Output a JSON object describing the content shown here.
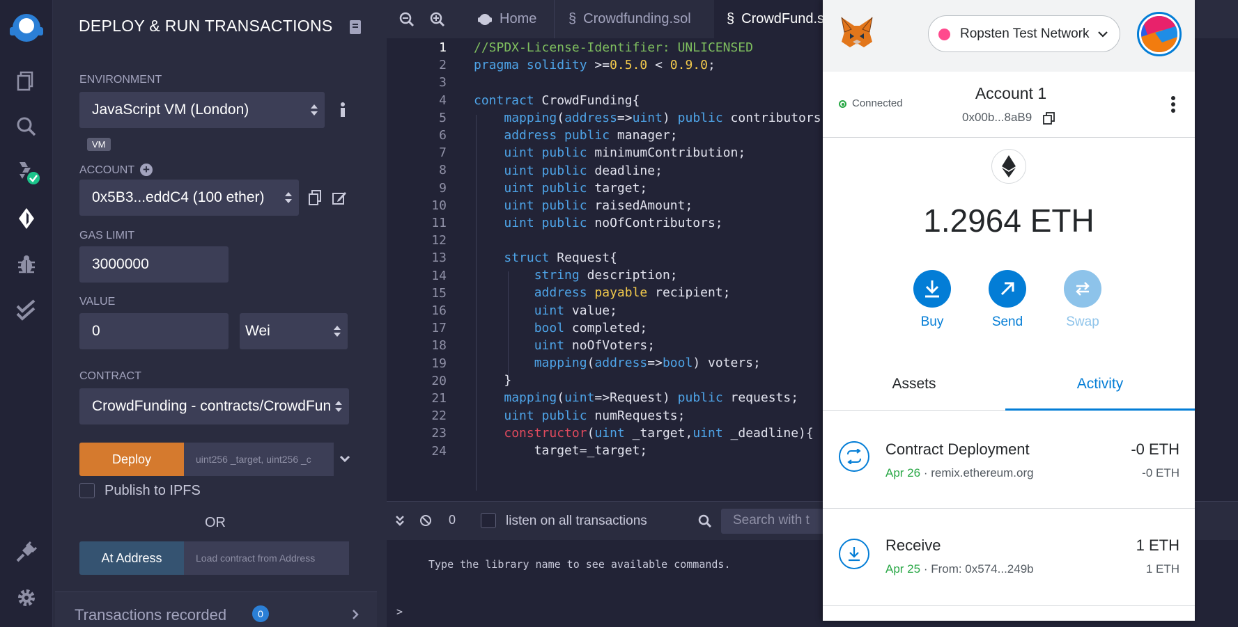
{
  "iconbar": {
    "items": [
      "remix-logo-icon",
      "file-explorer-icon",
      "search-icon",
      "compiler-icon",
      "deploy-icon",
      "debugger-icon",
      "testing-icon",
      "plugin-icon",
      "settings-icon"
    ]
  },
  "panel": {
    "title": "DEPLOY & RUN TRANSACTIONS",
    "environment_label": "ENVIRONMENT",
    "environment_value": "JavaScript VM (London)",
    "vm_badge": "VM",
    "account_label": "ACCOUNT",
    "account_value": "0x5B3...eddC4 (100 ether)",
    "gas_limit_label": "GAS LIMIT",
    "gas_limit_value": "3000000",
    "value_label": "VALUE",
    "value_amount": "0",
    "value_unit": "Wei",
    "contract_label": "CONTRACT",
    "contract_value": "CrowdFunding - contracts/CrowdFun",
    "deploy_label": "Deploy",
    "deploy_params_placeholder": "uint256 _target, uint256 _c",
    "publish_label": "Publish to IPFS",
    "or_label": "OR",
    "at_address_label": "At Address",
    "at_address_placeholder": "Load contract from Address",
    "transactions_recorded_label": "Transactions recorded",
    "transactions_recorded_count": "0"
  },
  "editor": {
    "tabs": [
      {
        "label": "Home"
      },
      {
        "label": "Crowdfunding.sol"
      },
      {
        "label": "CrowdFund.s"
      }
    ],
    "lines": [
      "1",
      "2",
      "3",
      "4",
      "5",
      "6",
      "7",
      "8",
      "9",
      "10",
      "11",
      "12",
      "13",
      "14",
      "15",
      "16",
      "17",
      "18",
      "19",
      "20",
      "21",
      "22",
      "23",
      "24"
    ]
  },
  "terminal": {
    "count": "0",
    "listen_label": "listen on all transactions",
    "search_placeholder": "Search with t",
    "message": "Type the library name to see available commands.",
    "prompt": ">"
  },
  "metamask": {
    "network": "Ropsten Test Network",
    "connected_label": "Connected",
    "account_name": "Account 1",
    "account_address": "0x00b...8aB9",
    "balance": "1.2964 ETH",
    "buy_label": "Buy",
    "send_label": "Send",
    "swap_label": "Swap",
    "assets_tab": "Assets",
    "activity_tab": "Activity",
    "activity": [
      {
        "title": "Contract Deployment",
        "date": "Apr 26",
        "detail": "remix.ethereum.org",
        "amount": "-0 ETH",
        "sub_amount": "-0 ETH"
      },
      {
        "title": "Receive",
        "date": "Apr 25",
        "detail": "From: 0x574...249b",
        "amount": "1 ETH",
        "sub_amount": "1 ETH"
      }
    ],
    "colors": {
      "accent": "#037dd6",
      "green": "#28a745"
    }
  }
}
